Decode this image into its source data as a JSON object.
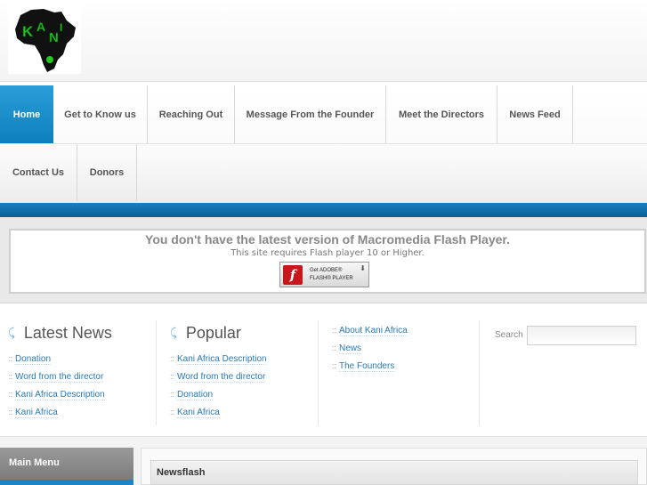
{
  "logo": {
    "text": "KANI"
  },
  "nav": {
    "items": [
      {
        "label": "Home",
        "active": true
      },
      {
        "label": "Get to Know us"
      },
      {
        "label": "Reaching Out"
      },
      {
        "label": "Message From the Founder"
      },
      {
        "label": "Meet the Directors"
      },
      {
        "label": "News Feed"
      },
      {
        "label": "Contact Us"
      },
      {
        "label": "Donors"
      }
    ]
  },
  "flash": {
    "title": "You don't have the latest version of Macromedia Flash Player.",
    "subtitle": "This site requires Flash player 10 or Higher.",
    "button_line1": "Get ADOBE®",
    "button_line2": "FLASH® PLAYER",
    "button_icon": "f"
  },
  "latest_news": {
    "title": "Latest News",
    "icon": "pin-icon",
    "items": [
      "Donation",
      "Word from the director",
      "Kani Africa Description",
      "Kani Africa"
    ]
  },
  "popular": {
    "title": "Popular",
    "icon": "pin-icon",
    "items": [
      "Kani Africa Description",
      "Word from the director",
      "Donation",
      "Kani Africa"
    ]
  },
  "extra_links": {
    "items": [
      "About Kani Africa",
      "News",
      "The Founders"
    ]
  },
  "search": {
    "label": "Search",
    "value": ""
  },
  "main_menu": {
    "title": "Main Menu"
  },
  "newsflash": {
    "title": "Newsflash"
  },
  "bullet": "::",
  "colors": {
    "accent": "#0d7fbd",
    "link": "#2a78b6",
    "logo_green": "#18b418"
  }
}
